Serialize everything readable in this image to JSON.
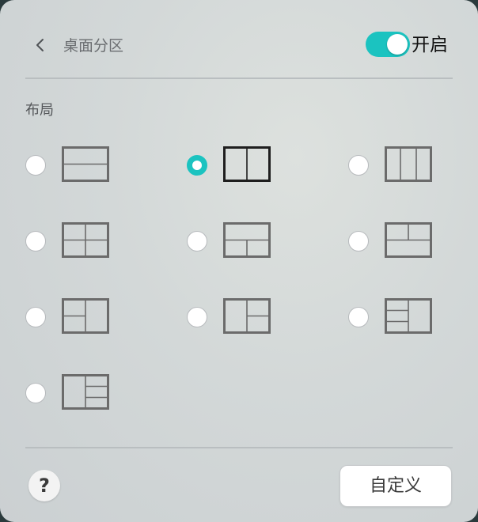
{
  "header": {
    "title": "桌面分区",
    "toggle_label": "开启",
    "toggle_on": true
  },
  "section": {
    "label": "布局"
  },
  "layouts": [
    {
      "id": "two-rows",
      "selected": false
    },
    {
      "id": "two-columns",
      "selected": true
    },
    {
      "id": "three-columns",
      "selected": false
    },
    {
      "id": "four-grid",
      "selected": false
    },
    {
      "id": "top-full-bottom-split",
      "selected": false
    },
    {
      "id": "top-split-bottom-full",
      "selected": false
    },
    {
      "id": "left-split-right-full",
      "selected": false
    },
    {
      "id": "left-full-right-split",
      "selected": false
    },
    {
      "id": "left-three-right-full",
      "selected": false
    },
    {
      "id": "left-full-right-three",
      "selected": false
    }
  ],
  "footer": {
    "help_symbol": "?",
    "custom_label": "自定义"
  },
  "colors": {
    "accent": "#1bc3c0",
    "icon_stroke": "#6b6b6b",
    "icon_stroke_selected": "#1e1e1e"
  }
}
